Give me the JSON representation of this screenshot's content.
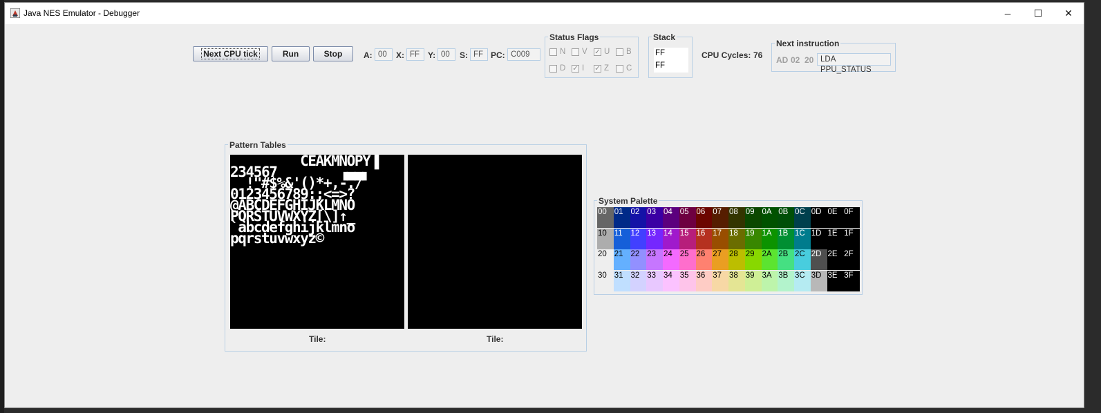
{
  "window": {
    "title": "Java NES Emulator - Debugger",
    "controls": {
      "minimize": "─",
      "maximize": "☐",
      "close": "✕"
    }
  },
  "toolbar": {
    "next_cpu_tick_label": "Next CPU tick",
    "run_label": "Run",
    "stop_label": "Stop"
  },
  "registers": {
    "a_label": "A:",
    "a_value": "00",
    "x_label": "X:",
    "x_value": "FF",
    "y_label": "Y:",
    "y_value": "00",
    "s_label": "S:",
    "s_value": "FF",
    "pc_label": "PC:",
    "pc_value": "C009"
  },
  "status_flags": {
    "title": "Status Flags",
    "flags": [
      {
        "name": "N",
        "checked": false
      },
      {
        "name": "V",
        "checked": false
      },
      {
        "name": "U",
        "checked": true
      },
      {
        "name": "B",
        "checked": false
      },
      {
        "name": "D",
        "checked": false
      },
      {
        "name": "I",
        "checked": true
      },
      {
        "name": "Z",
        "checked": true
      },
      {
        "name": "C",
        "checked": false
      }
    ]
  },
  "stack": {
    "title": "Stack",
    "items": [
      "FF",
      "FF"
    ]
  },
  "cpu_cycles": {
    "label": "CPU Cycles:",
    "value": "76"
  },
  "next_instruction": {
    "title": "Next instruction",
    "bytes": [
      "AD",
      "02",
      "20"
    ],
    "mnemonic": "LDA PPU_STATUS"
  },
  "pattern_tables": {
    "title": "Pattern Tables",
    "left_rows": [
      "  ▔▔▔▔▔  CEAKMNOPY▐",
      "234567        ▗▄▄▖",
      "  !\"#$%&'()*+,-./",
      "0123456789:;<=>?",
      "@ABCDEFGHIJKLMNO",
      "PQRSTUVWXYZ[\\]↑_",
      "`abcdefghijklmno",
      "pqrstuvwxyz©"
    ],
    "left_tile_label": "Tile:",
    "right_tile_label": "Tile:"
  },
  "system_palette": {
    "title": "System Palette",
    "rows": [
      [
        {
          "code": "00",
          "color": "#666666",
          "text": "#ffffff"
        },
        {
          "code": "01",
          "color": "#002a88",
          "text": "#ffffff"
        },
        {
          "code": "02",
          "color": "#1412a7",
          "text": "#ffffff"
        },
        {
          "code": "03",
          "color": "#3b00a4",
          "text": "#ffffff"
        },
        {
          "code": "04",
          "color": "#5c007e",
          "text": "#ffffff"
        },
        {
          "code": "05",
          "color": "#6e0040",
          "text": "#ffffff"
        },
        {
          "code": "06",
          "color": "#6c0600",
          "text": "#ffffff"
        },
        {
          "code": "07",
          "color": "#561d00",
          "text": "#ffffff"
        },
        {
          "code": "08",
          "color": "#333500",
          "text": "#ffffff"
        },
        {
          "code": "09",
          "color": "#0b4800",
          "text": "#ffffff"
        },
        {
          "code": "0A",
          "color": "#005200",
          "text": "#ffffff"
        },
        {
          "code": "0B",
          "color": "#004f08",
          "text": "#ffffff"
        },
        {
          "code": "0C",
          "color": "#00404d",
          "text": "#ffffff"
        },
        {
          "code": "0D",
          "color": "#000000",
          "text": "#ffffff"
        },
        {
          "code": "0E",
          "color": "#000000",
          "text": "#ffffff"
        },
        {
          "code": "0F",
          "color": "#000000",
          "text": "#ffffff"
        }
      ],
      [
        {
          "code": "10",
          "color": "#adadad",
          "text": "#000000"
        },
        {
          "code": "11",
          "color": "#155fd9",
          "text": "#ffffff"
        },
        {
          "code": "12",
          "color": "#4240ff",
          "text": "#ffffff"
        },
        {
          "code": "13",
          "color": "#7527fe",
          "text": "#ffffff"
        },
        {
          "code": "14",
          "color": "#a01acc",
          "text": "#ffffff"
        },
        {
          "code": "15",
          "color": "#b71e7b",
          "text": "#ffffff"
        },
        {
          "code": "16",
          "color": "#b53120",
          "text": "#ffffff"
        },
        {
          "code": "17",
          "color": "#994e00",
          "text": "#ffffff"
        },
        {
          "code": "18",
          "color": "#6b6d00",
          "text": "#ffffff"
        },
        {
          "code": "19",
          "color": "#388700",
          "text": "#ffffff"
        },
        {
          "code": "1A",
          "color": "#0c9300",
          "text": "#ffffff"
        },
        {
          "code": "1B",
          "color": "#008f32",
          "text": "#ffffff"
        },
        {
          "code": "1C",
          "color": "#007c8d",
          "text": "#ffffff"
        },
        {
          "code": "1D",
          "color": "#000000",
          "text": "#ffffff"
        },
        {
          "code": "1E",
          "color": "#000000",
          "text": "#ffffff"
        },
        {
          "code": "1F",
          "color": "#000000",
          "text": "#ffffff"
        }
      ],
      [
        {
          "code": "20",
          "color": "#eeeeee",
          "text": "#000000"
        },
        {
          "code": "21",
          "color": "#64b0ff",
          "text": "#000000"
        },
        {
          "code": "22",
          "color": "#9290ff",
          "text": "#000000"
        },
        {
          "code": "23",
          "color": "#c676ff",
          "text": "#000000"
        },
        {
          "code": "24",
          "color": "#f36aff",
          "text": "#000000"
        },
        {
          "code": "25",
          "color": "#fe6ecc",
          "text": "#000000"
        },
        {
          "code": "26",
          "color": "#fe8170",
          "text": "#000000"
        },
        {
          "code": "27",
          "color": "#ea9e22",
          "text": "#000000"
        },
        {
          "code": "28",
          "color": "#bcbe00",
          "text": "#000000"
        },
        {
          "code": "29",
          "color": "#88d800",
          "text": "#000000"
        },
        {
          "code": "2A",
          "color": "#5ce430",
          "text": "#000000"
        },
        {
          "code": "2B",
          "color": "#45e082",
          "text": "#000000"
        },
        {
          "code": "2C",
          "color": "#48cdde",
          "text": "#000000"
        },
        {
          "code": "2D",
          "color": "#4f4f4f",
          "text": "#ffffff"
        },
        {
          "code": "2E",
          "color": "#000000",
          "text": "#ffffff"
        },
        {
          "code": "2F",
          "color": "#000000",
          "text": "#ffffff"
        }
      ],
      [
        {
          "code": "30",
          "color": "#eeeeee",
          "text": "#000000"
        },
        {
          "code": "31",
          "color": "#c0dfff",
          "text": "#000000"
        },
        {
          "code": "32",
          "color": "#d3d2ff",
          "text": "#000000"
        },
        {
          "code": "33",
          "color": "#e8c8ff",
          "text": "#000000"
        },
        {
          "code": "34",
          "color": "#fbc2ff",
          "text": "#000000"
        },
        {
          "code": "35",
          "color": "#fec4ea",
          "text": "#000000"
        },
        {
          "code": "36",
          "color": "#feccc5",
          "text": "#000000"
        },
        {
          "code": "37",
          "color": "#f7d8a5",
          "text": "#000000"
        },
        {
          "code": "38",
          "color": "#e4e594",
          "text": "#000000"
        },
        {
          "code": "39",
          "color": "#cfef96",
          "text": "#000000"
        },
        {
          "code": "3A",
          "color": "#bdf4ab",
          "text": "#000000"
        },
        {
          "code": "3B",
          "color": "#b3f3cc",
          "text": "#000000"
        },
        {
          "code": "3C",
          "color": "#b5ebf2",
          "text": "#000000"
        },
        {
          "code": "3D",
          "color": "#b8b8b8",
          "text": "#000000"
        },
        {
          "code": "3E",
          "color": "#000000",
          "text": "#ffffff"
        },
        {
          "code": "3F",
          "color": "#000000",
          "text": "#ffffff"
        }
      ]
    ]
  }
}
